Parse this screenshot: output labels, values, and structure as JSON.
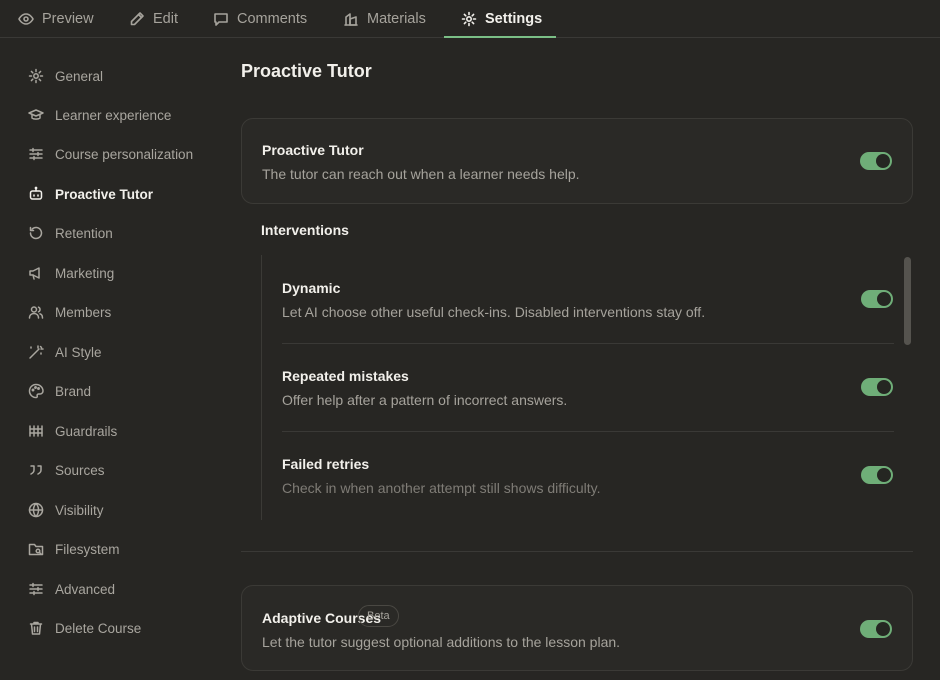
{
  "tabs": [
    {
      "label": "Preview",
      "icon": "eye-icon"
    },
    {
      "label": "Edit",
      "icon": "pencil-icon"
    },
    {
      "label": "Comments",
      "icon": "comment-icon"
    },
    {
      "label": "Materials",
      "icon": "materials-icon"
    },
    {
      "label": "Settings",
      "icon": "gear-icon",
      "active": true
    }
  ],
  "sidebar": {
    "items": [
      {
        "label": "General",
        "icon": "gear-icon"
      },
      {
        "label": "Learner experience",
        "icon": "graduation-cap-icon"
      },
      {
        "label": "Course personalization",
        "icon": "sliders-icon"
      },
      {
        "label": "Proactive Tutor",
        "icon": "robot-icon",
        "active": true
      },
      {
        "label": "Retention",
        "icon": "history-icon"
      },
      {
        "label": "Marketing",
        "icon": "megaphone-icon"
      },
      {
        "label": "Members",
        "icon": "users-icon"
      },
      {
        "label": "AI Style",
        "icon": "magic-wand-icon"
      },
      {
        "label": "Brand",
        "icon": "palette-icon"
      },
      {
        "label": "Guardrails",
        "icon": "guardrails-icon"
      },
      {
        "label": "Sources",
        "icon": "quote-icon"
      },
      {
        "label": "Visibility",
        "icon": "globe-icon"
      },
      {
        "label": "Filesystem",
        "icon": "folder-icon"
      },
      {
        "label": "Advanced",
        "icon": "sliders-icon"
      },
      {
        "label": "Delete Course",
        "icon": "trash-icon"
      }
    ]
  },
  "main": {
    "page_title": "Proactive Tutor",
    "tutor_card": {
      "title": "Proactive Tutor",
      "description": "The tutor can reach out when a learner needs help.",
      "enabled": true
    },
    "interventions_label": "Interventions",
    "interventions": [
      {
        "title": "Dynamic",
        "description": "Let AI choose other useful check-ins. Disabled interventions stay off.",
        "enabled": true
      },
      {
        "title": "Repeated mistakes",
        "description": "Offer help after a pattern of incorrect answers.",
        "enabled": true
      },
      {
        "title": "Failed retries",
        "description": "Check in when another attempt still shows difficulty.",
        "enabled": true
      }
    ],
    "adaptive_card": {
      "title": "Adaptive Courses",
      "badge": "Beta",
      "description": "Let the tutor suggest optional additions to the lesson plan.",
      "enabled": true
    }
  },
  "colors": {
    "background": "#272623",
    "accent": "#7bbf86",
    "toggle_on": "#6fae78"
  }
}
